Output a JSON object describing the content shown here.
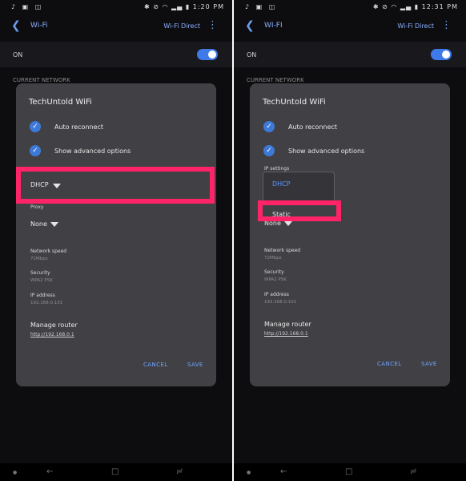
{
  "left": {
    "status": {
      "time": "1:20 PM"
    },
    "appbar": {
      "title": "Wi-Fi",
      "wifi_direct": "Wi-Fi Direct"
    },
    "on_label": "ON",
    "current_network": "CURRENT NETWORK",
    "dialog": {
      "title": "TechUntold WiFi",
      "auto_reconnect": "Auto reconnect",
      "show_advanced": "Show advanced options",
      "dhcp": "DHCP",
      "proxy": "Proxy",
      "none": "None",
      "network_speed": "Network speed",
      "network_speed_value": "72Mbps",
      "security": "Security",
      "security_value": "WPA2 PSK",
      "ip_address": "IP address",
      "ip_address_value": "192.168.0.101",
      "manage_router": "Manage router",
      "router_link": "http://192.168.0.1",
      "cancel": "CANCEL",
      "save": "SAVE"
    }
  },
  "right": {
    "status": {
      "time": "12:31 PM"
    },
    "appbar": {
      "title": "WI-FI",
      "wifi_direct": "Wi-Fi Direct"
    },
    "on_label": "ON",
    "current_network": "CURRENT NETWORK",
    "dialog": {
      "title": "TechUntold WiFi",
      "auto_reconnect": "Auto reconnect",
      "show_advanced": "Show advanced options",
      "ip_settings": "IP settings",
      "dropdown_options": [
        "DHCP",
        "Static"
      ],
      "none": "None",
      "network_speed": "Network speed",
      "network_speed_value": "72Mbps",
      "security": "Security",
      "security_value": "WPA2 PSK",
      "ip_address": "IP address",
      "ip_address_value": "192.168.0.101",
      "manage_router": "Manage router",
      "router_link": "http://192.168.0.1",
      "cancel": "CANCEL",
      "save": "SAVE"
    }
  },
  "colors": {
    "highlight": "#ff2468",
    "accent": "#3e7ae8"
  }
}
